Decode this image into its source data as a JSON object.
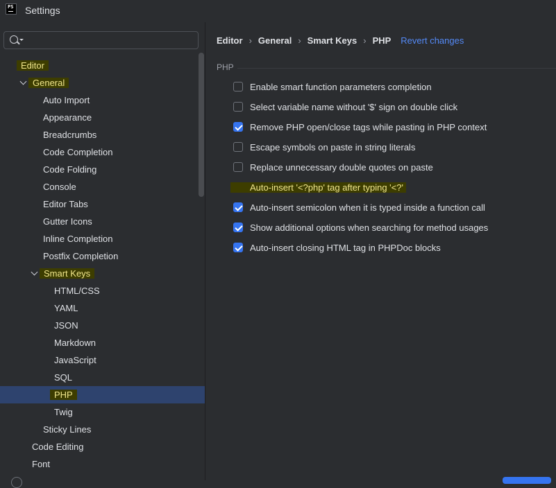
{
  "window": {
    "title": "Settings",
    "logo_text": "PS"
  },
  "search": {
    "value": "",
    "placeholder": ""
  },
  "tree": [
    {
      "label": "Editor",
      "level": 0,
      "highlighted": true
    },
    {
      "label": "General",
      "level": 1,
      "expanded": true,
      "highlighted": true
    },
    {
      "label": "Auto Import",
      "level": 2
    },
    {
      "label": "Appearance",
      "level": 2
    },
    {
      "label": "Breadcrumbs",
      "level": 2
    },
    {
      "label": "Code Completion",
      "level": 2
    },
    {
      "label": "Code Folding",
      "level": 2
    },
    {
      "label": "Console",
      "level": 2
    },
    {
      "label": "Editor Tabs",
      "level": 2
    },
    {
      "label": "Gutter Icons",
      "level": 2
    },
    {
      "label": "Inline Completion",
      "level": 2
    },
    {
      "label": "Postfix Completion",
      "level": 2
    },
    {
      "label": "Smart Keys",
      "level": 2,
      "expanded": true,
      "highlighted": true
    },
    {
      "label": "HTML/CSS",
      "level": 3
    },
    {
      "label": "YAML",
      "level": 3
    },
    {
      "label": "JSON",
      "level": 3
    },
    {
      "label": "Markdown",
      "level": 3
    },
    {
      "label": "JavaScript",
      "level": 3
    },
    {
      "label": "SQL",
      "level": 3
    },
    {
      "label": "PHP",
      "level": 3,
      "selected": true,
      "highlighted": true
    },
    {
      "label": "Twig",
      "level": 3
    },
    {
      "label": "Sticky Lines",
      "level": 2
    },
    {
      "label": "Code Editing",
      "level": 1
    },
    {
      "label": "Font",
      "level": 1
    }
  ],
  "breadcrumb": {
    "items": [
      "Editor",
      "General",
      "Smart Keys",
      "PHP"
    ],
    "separator": "›",
    "revert": "Revert changes"
  },
  "section": {
    "label": "PHP"
  },
  "options": [
    {
      "label": "Enable smart function parameters completion",
      "checked": false
    },
    {
      "label": "Select variable name without '$' sign on double click",
      "checked": false
    },
    {
      "label": "Remove PHP open/close tags while pasting in PHP context",
      "checked": true
    },
    {
      "label": "Escape symbols on paste in string literals",
      "checked": false
    },
    {
      "label": "Replace unnecessary double quotes on paste",
      "checked": false
    },
    {
      "label": "Auto-insert '<?php' tag after typing '<?'",
      "checked": false,
      "highlighted": true,
      "focused": true
    },
    {
      "label": "Auto-insert semicolon when it is typed inside a function call",
      "checked": true
    },
    {
      "label": "Show additional options when searching for method usages",
      "checked": true
    },
    {
      "label": "Auto-insert closing HTML tag in PHPDoc blocks",
      "checked": true
    }
  ],
  "colors": {
    "background": "#2b2d30",
    "accent": "#3574f0",
    "selection": "#2e436e",
    "highlight": "#f0e68c",
    "link": "#548af7"
  }
}
